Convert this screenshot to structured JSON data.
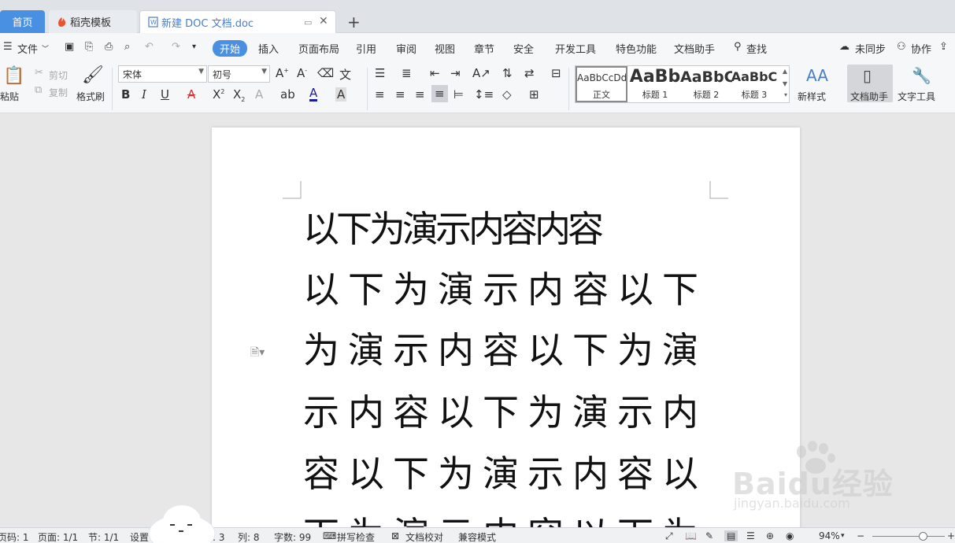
{
  "tabs": {
    "home": "首页",
    "docer": "稻壳模板",
    "document": "新建 DOC 文档.doc",
    "new_tab": "+"
  },
  "menu": {
    "file": "文件",
    "items": [
      "开始",
      "插入",
      "页面布局",
      "引用",
      "审阅",
      "视图",
      "章节",
      "安全",
      "开发工具",
      "特色功能",
      "文档助手"
    ],
    "search": "查找",
    "sync": "未同步",
    "collab": "协作"
  },
  "ribbon": {
    "paste": "粘贴",
    "cut": "剪切",
    "copy": "复制",
    "format_painter": "格式刷",
    "font_name": "宋体",
    "font_size": "初号",
    "styles": [
      {
        "preview": "AaBbCcDd",
        "label": "正文"
      },
      {
        "preview": "AaBb",
        "label": "标题 1"
      },
      {
        "preview": "AaBbC",
        "label": "标题 2"
      },
      {
        "preview": "AaBbC",
        "label": "标题 3"
      }
    ],
    "new_style": "新样式",
    "doc_helper": "文档助手",
    "text_tools": "文字工具"
  },
  "document": {
    "lines": [
      "以下为演示内容内容",
      "以下为演示内容以下",
      "为演示内容以下为演",
      "示内容以下为演示内",
      "容以下为演示内容以",
      "下为演示内容以下为"
    ]
  },
  "status": {
    "page_num": "页码: 1",
    "pages": "页面: 1/1",
    "section": "节: 1/1",
    "settings": "设置",
    "line": "行: 3",
    "col": "列: 8",
    "word_count": "字数: 99",
    "spell_check": "拼写检查",
    "proofread": "文档校对",
    "compat_mode": "兼容模式",
    "zoom": "94%"
  },
  "watermark": {
    "brand": "Baidu经验",
    "url": "jingyan.baidu.com"
  },
  "colors": {
    "accent": "#4a90e2",
    "tab_bar": "#dfe3e8",
    "ribbon_bg": "#f6f7f9",
    "canvas": "#e7e7e7"
  }
}
